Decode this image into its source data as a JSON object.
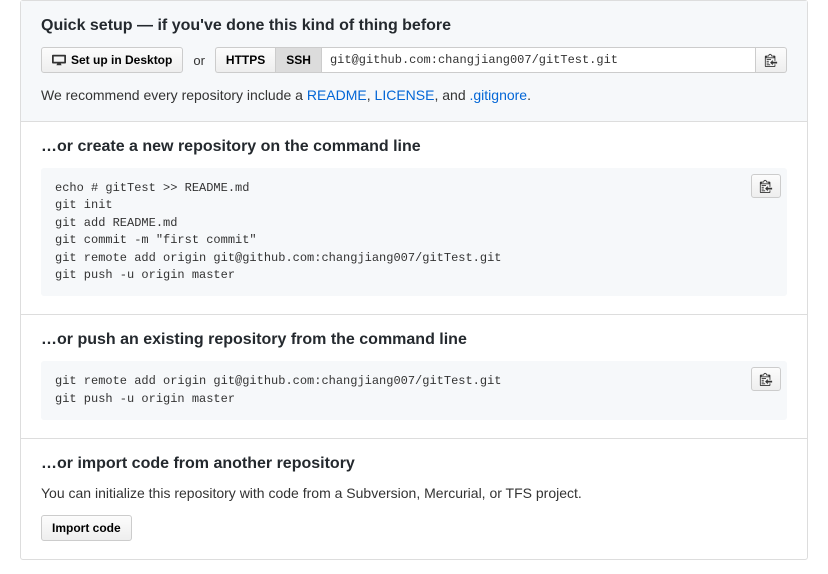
{
  "quick_setup": {
    "title": "Quick setup — if you've done this kind of thing before",
    "desktop_button": "Set up in Desktop",
    "or": "or",
    "protocols": {
      "https": "HTTPS",
      "ssh": "SSH",
      "selected": "ssh"
    },
    "clone_url": "git@github.com:changjiang007/gitTest.git",
    "recommend_prefix": "We recommend every repository include a ",
    "readme_link": "README",
    "comma_sep": ", ",
    "license_link": "LICENSE",
    "and_sep": ", and ",
    "gitignore_link": ".gitignore",
    "period": "."
  },
  "create_new": {
    "title": "…or create a new repository on the command line",
    "code": "echo # gitTest >> README.md\ngit init\ngit add README.md\ngit commit -m \"first commit\"\ngit remote add origin git@github.com:changjiang007/gitTest.git\ngit push -u origin master"
  },
  "push_existing": {
    "title": "…or push an existing repository from the command line",
    "code": "git remote add origin git@github.com:changjiang007/gitTest.git\ngit push -u origin master"
  },
  "import_section": {
    "title": "…or import code from another repository",
    "description": "You can initialize this repository with code from a Subversion, Mercurial, or TFS project.",
    "button": "Import code"
  }
}
